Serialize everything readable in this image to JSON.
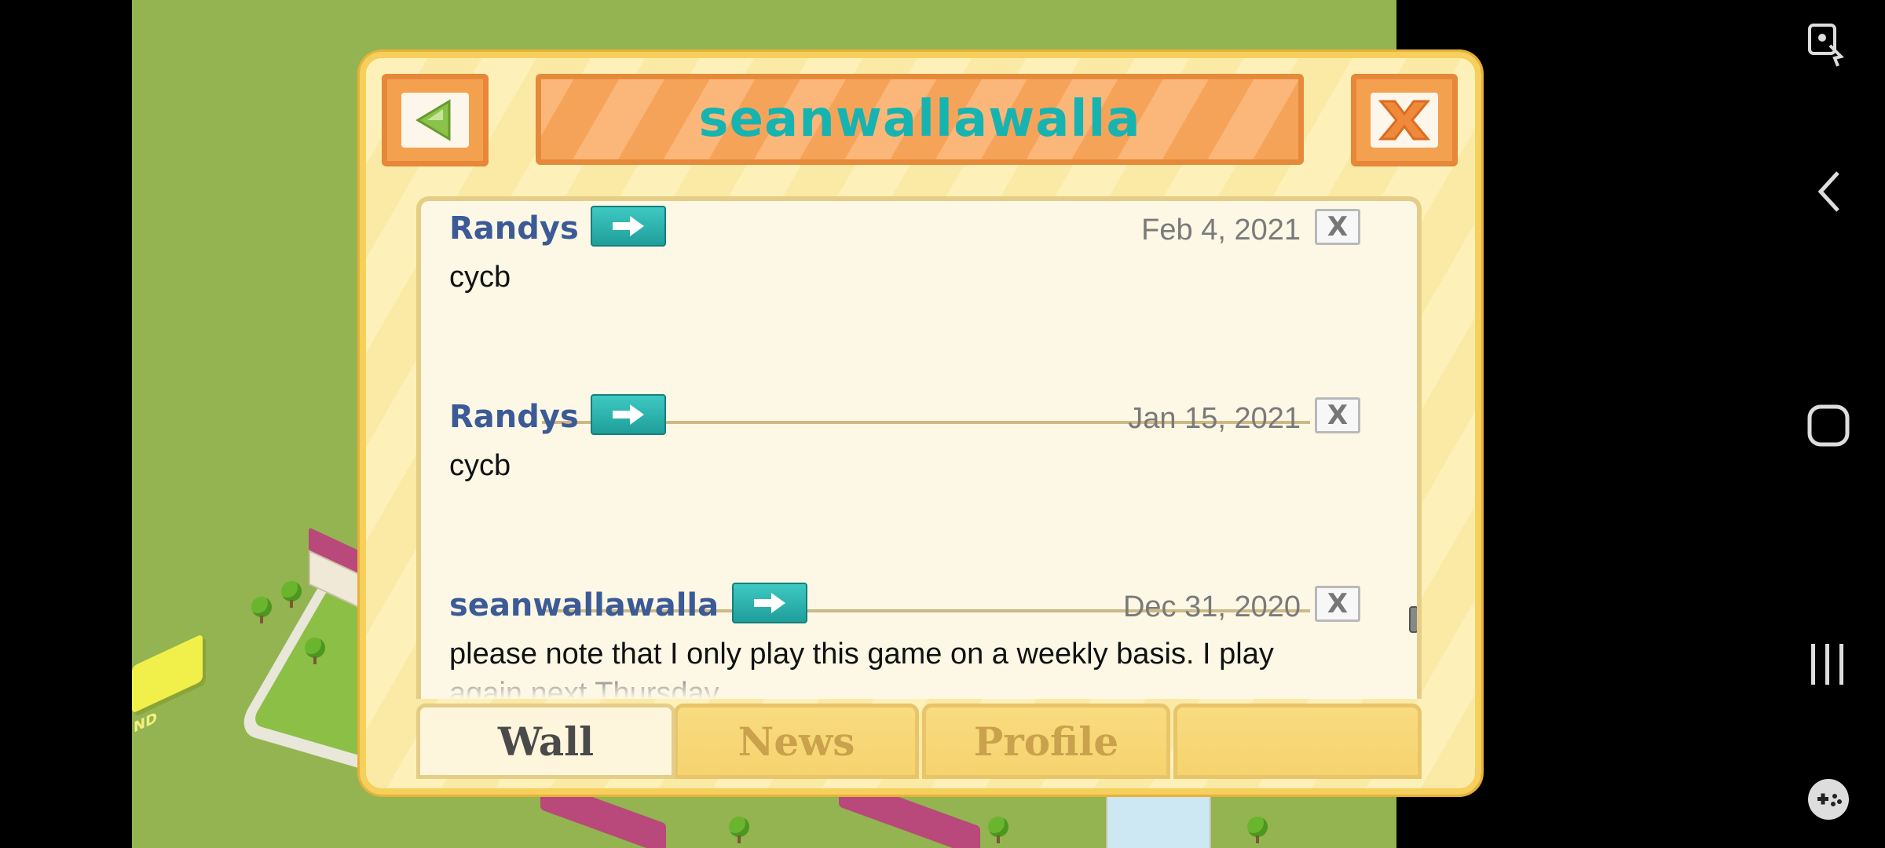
{
  "header": {
    "title": "seanwallawalla",
    "back_icon": "back-arrow-icon",
    "close_icon": "close-x-icon"
  },
  "posts": [
    {
      "author": "Randys",
      "date": "Feb 4, 2021",
      "message": "cycb",
      "delete_label": "X"
    },
    {
      "author": "Randys",
      "date": "Jan 15, 2021",
      "message": "cycb",
      "delete_label": "X"
    },
    {
      "author": "seanwallawalla",
      "date": "Dec 31, 2020",
      "message": "please note that I only play this game on a weekly basis. I play",
      "message_cut": "again next Thursday",
      "delete_label": "X"
    }
  ],
  "tabs": [
    {
      "label": "Wall",
      "active": true
    },
    {
      "label": "News",
      "active": false
    },
    {
      "label": "Profile",
      "active": false
    },
    {
      "label": "",
      "active": false
    }
  ],
  "game_sign": "ND",
  "colors": {
    "title": "#17b3b0",
    "author": "#3b5a96",
    "accent_orange": "#f3a14f",
    "dialog_border": "#f6cf5c"
  }
}
